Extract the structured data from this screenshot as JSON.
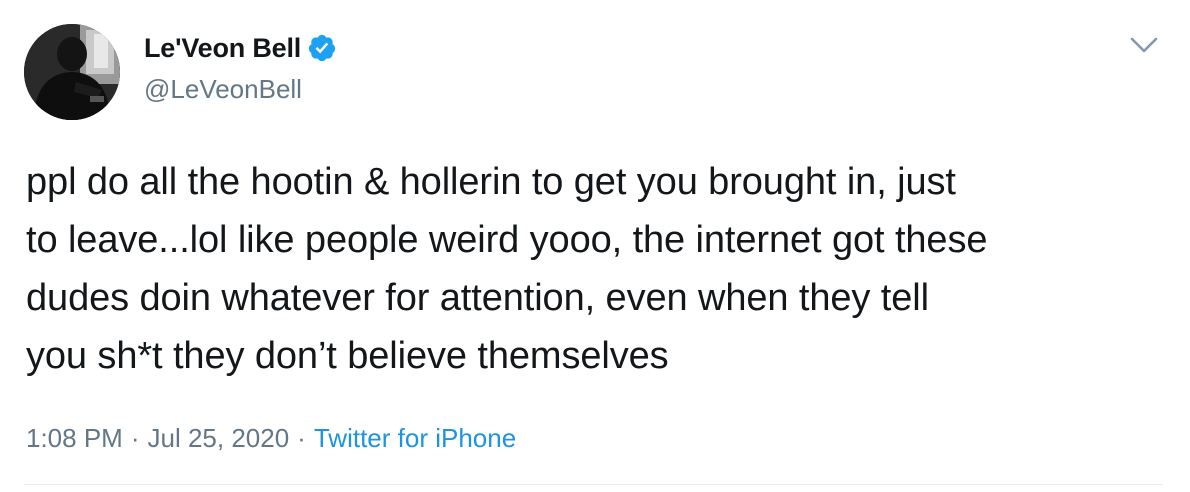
{
  "tweet": {
    "author": {
      "display_name": "Le'Veon Bell",
      "handle": "@LeVeonBell",
      "verified": true,
      "avatar_icon": "profile-photo-icon"
    },
    "text_lines": [
      "ppl do all the hootin & hollerin to get you brought in, just",
      "to leave...lol like people weird yooo, the internet got these",
      "dudes doin whatever for attention, even when they tell",
      "you sh*t they don’t believe themselves"
    ],
    "meta": {
      "time": "1:08 PM",
      "separator": "·",
      "date": "Jul 25, 2020",
      "source": "Twitter for iPhone"
    },
    "menu_icon": "chevron-down-icon"
  },
  "colors": {
    "text_primary": "#14171a",
    "text_secondary": "#657786",
    "link_blue": "#1b95e0",
    "verified_blue": "#1da1f2",
    "divider": "#e6ecf0"
  }
}
